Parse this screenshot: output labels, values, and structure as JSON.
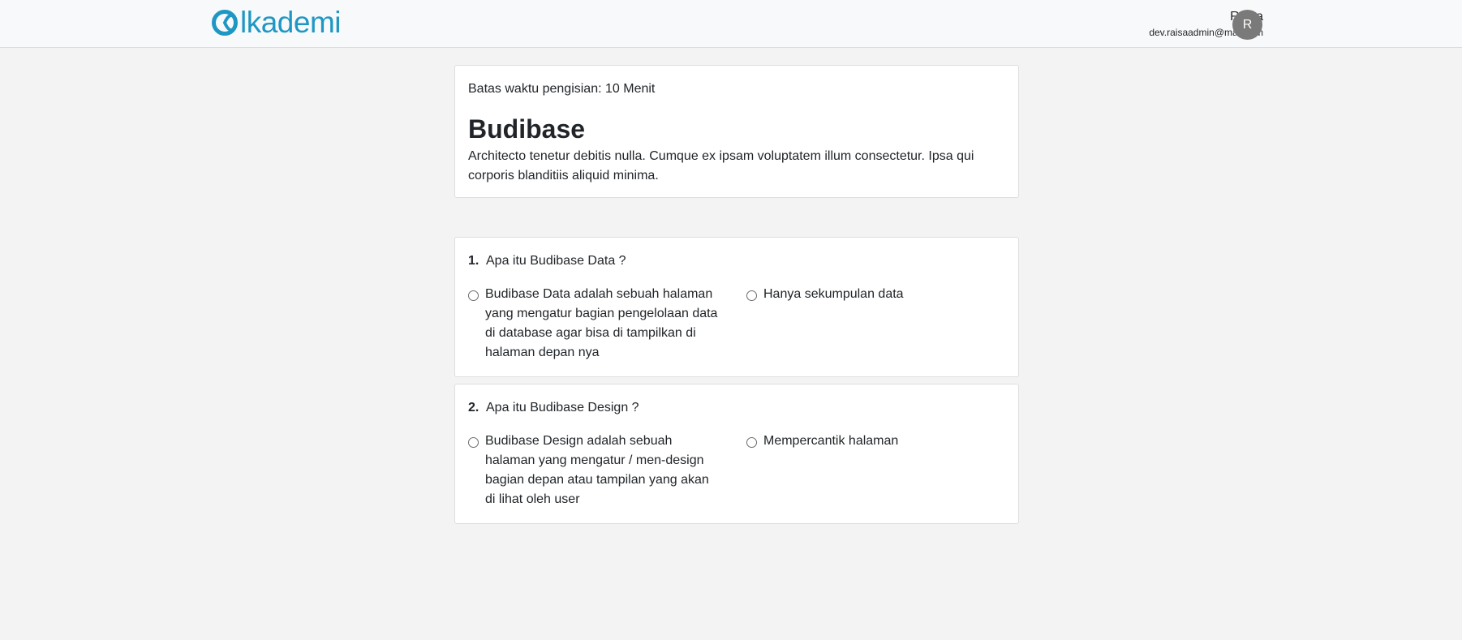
{
  "header": {
    "logo_text": "lkademi",
    "user_name": "Raisa",
    "user_email": "dev.raisaadmin@mail.com",
    "avatar_initial": "R",
    "brand_color": "#1f97c4"
  },
  "quiz": {
    "time_limit": "Batas waktu pengisian: 10 Menit",
    "title": "Budibase",
    "description": "Architecto tenetur debitis nulla. Cumque ex ipsam voluptatem illum consectetur. Ipsa qui corporis blanditiis aliquid minima."
  },
  "questions": [
    {
      "number": "1.",
      "text": "Apa itu Budibase Data ?",
      "options": [
        "Budibase Data adalah sebuah halaman yang mengatur bagian pengelolaan data di database agar bisa di tampilkan di halaman depan nya",
        "Hanya sekumpulan data"
      ]
    },
    {
      "number": "2.",
      "text": "Apa itu Budibase Design ?",
      "options": [
        "Budibase Design adalah sebuah halaman yang mengatur / men-design bagian depan atau tampilan yang akan di lihat oleh user",
        "Mempercantik halaman"
      ]
    }
  ]
}
